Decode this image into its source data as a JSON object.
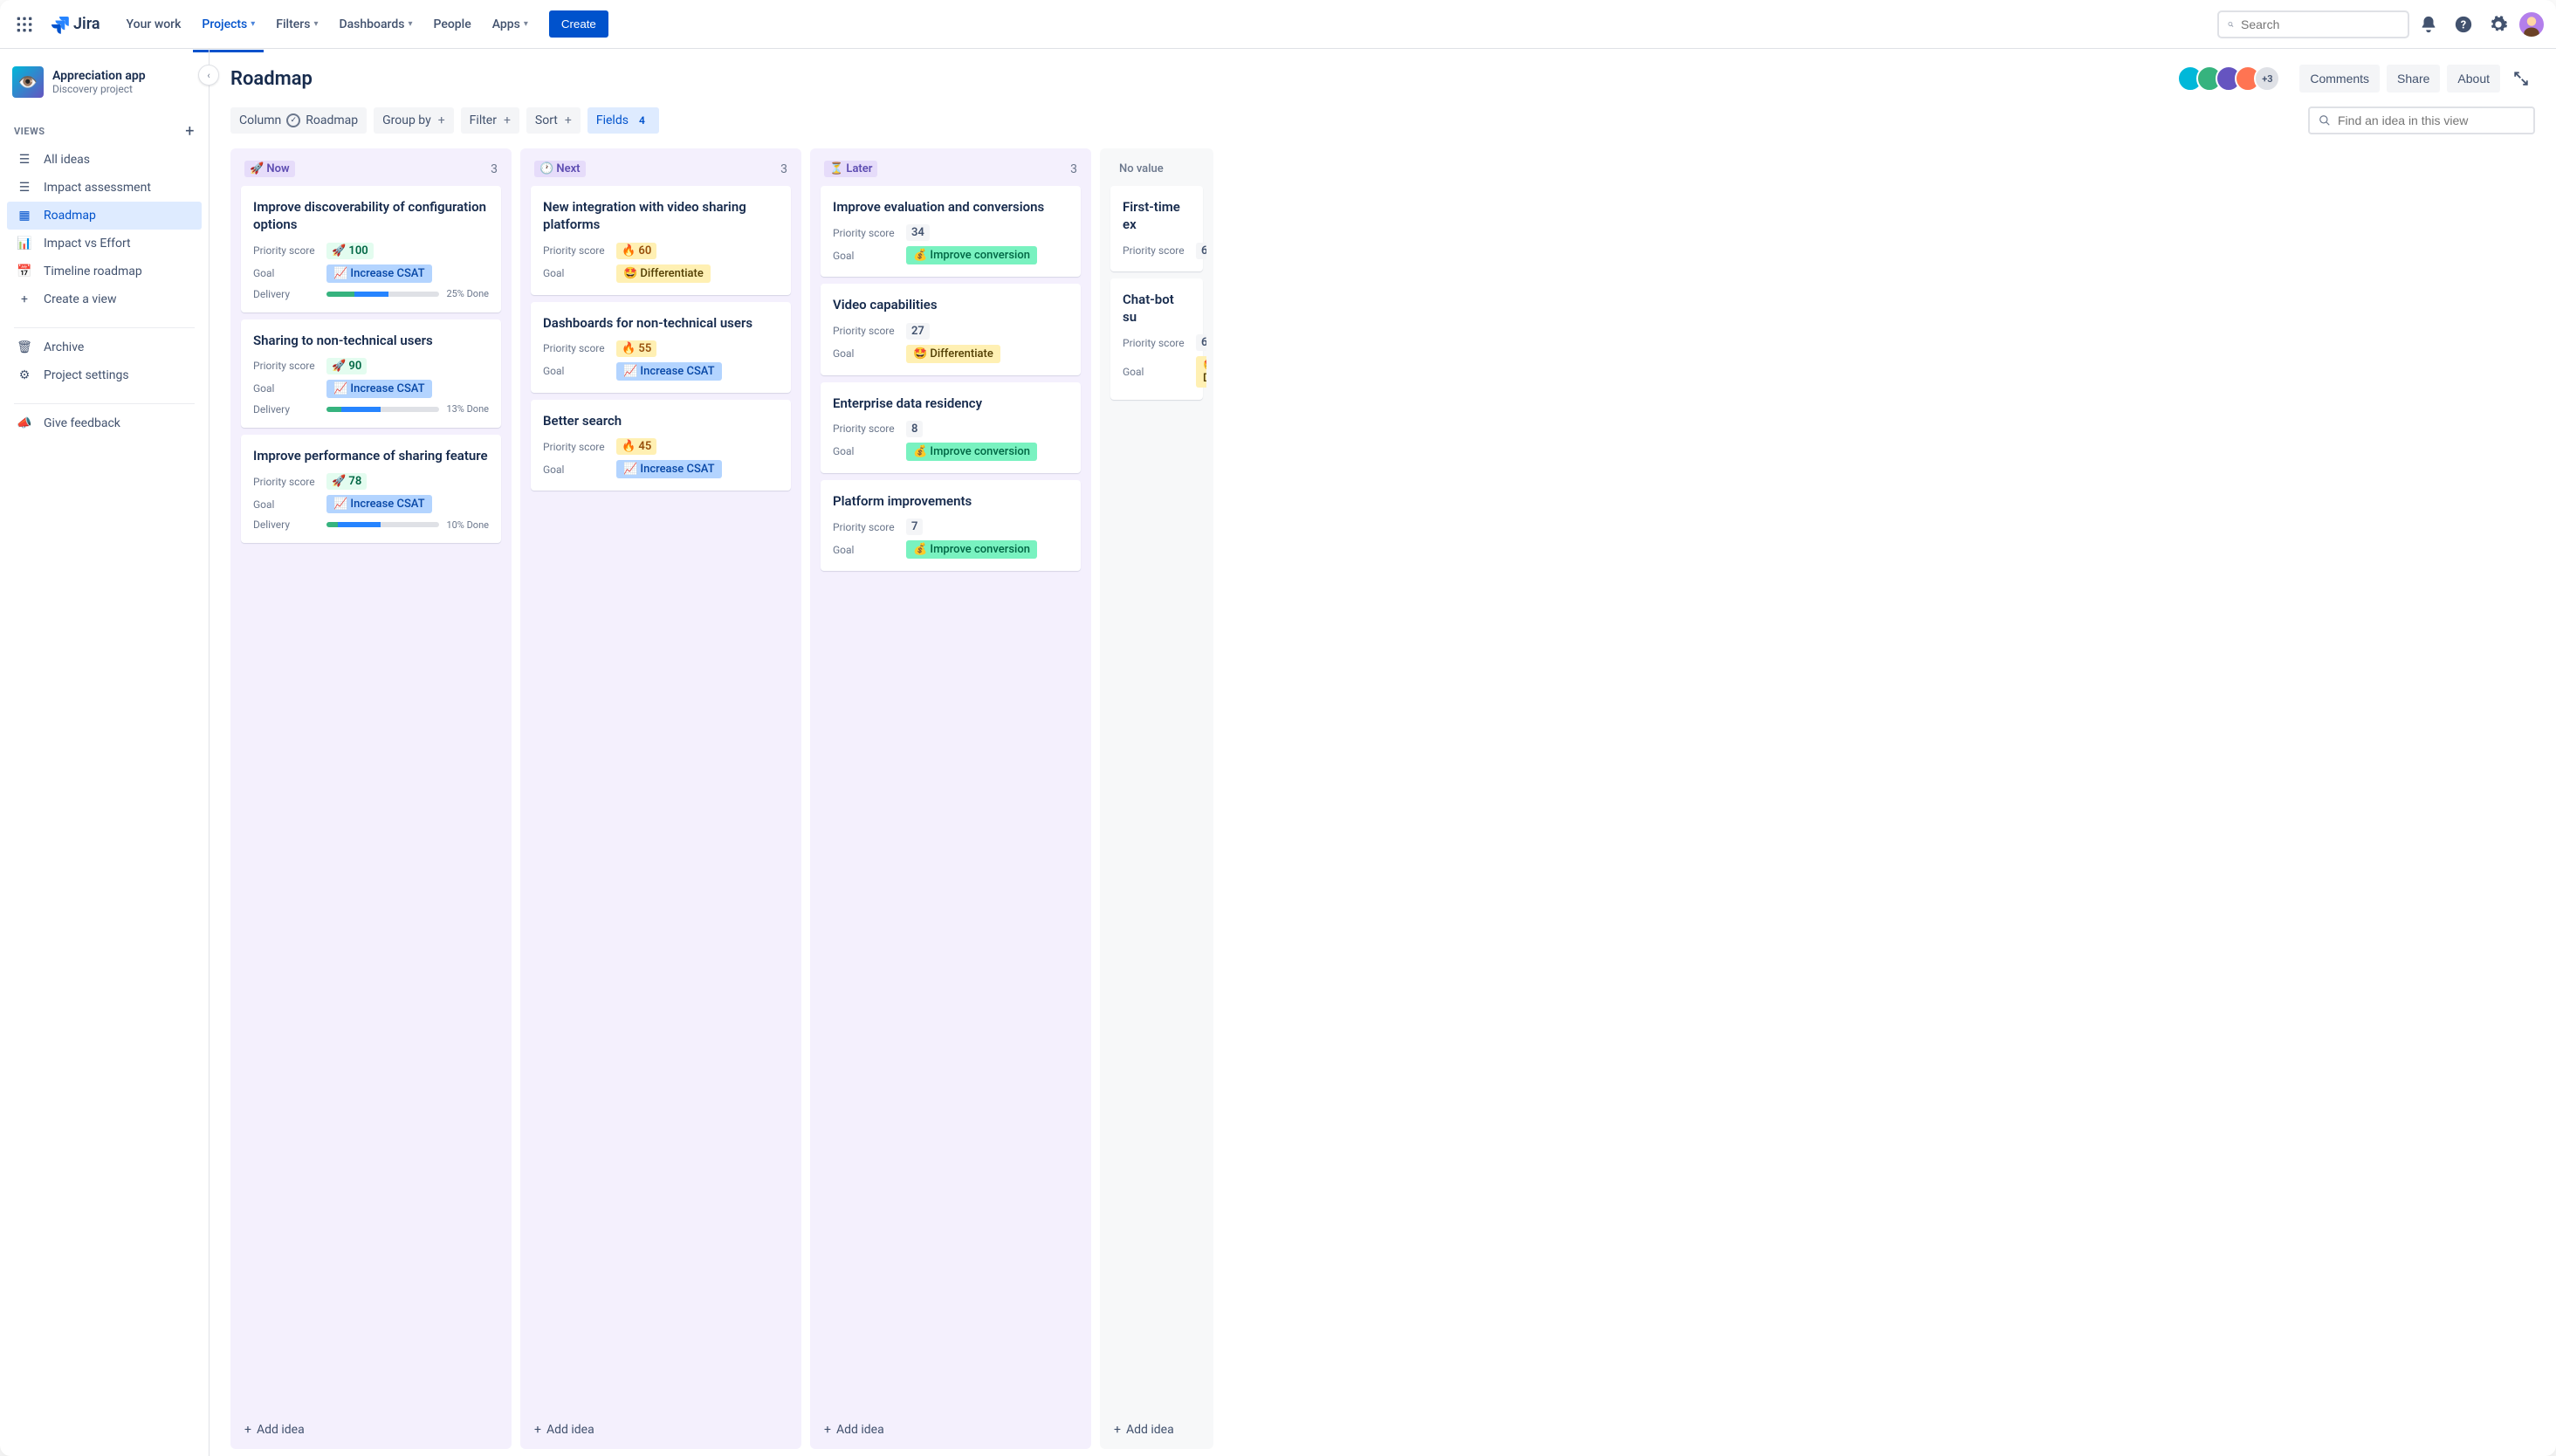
{
  "topnav": {
    "product": "Jira",
    "items": [
      "Your work",
      "Projects",
      "Filters",
      "Dashboards",
      "People",
      "Apps"
    ],
    "items_with_chevron": [
      false,
      true,
      true,
      true,
      false,
      true
    ],
    "active_index": 1,
    "create": "Create",
    "search_placeholder": "Search"
  },
  "sidebar": {
    "project_name": "Appreciation app",
    "project_type": "Discovery project",
    "views_label": "VIEWS",
    "views": [
      {
        "label": "All ideas",
        "icon": "list"
      },
      {
        "label": "Impact assessment",
        "icon": "list"
      },
      {
        "label": "Roadmap",
        "icon": "board",
        "selected": true
      },
      {
        "label": "Impact vs Effort",
        "icon": "chart"
      },
      {
        "label": "Timeline roadmap",
        "icon": "timeline"
      },
      {
        "label": "Create a view",
        "icon": "plus"
      }
    ],
    "archive": "Archive",
    "settings": "Project settings",
    "feedback": "Give feedback"
  },
  "header": {
    "title": "Roadmap",
    "avatar_extra": "+3",
    "comments": "Comments",
    "share": "Share",
    "about": "About"
  },
  "toolbar": {
    "column_label": "Column",
    "column_value": "Roadmap",
    "group_by": "Group by",
    "filter": "Filter",
    "sort": "Sort",
    "fields": "Fields",
    "fields_count": "4",
    "find_placeholder": "Find an idea in this view"
  },
  "field_labels": {
    "priority": "Priority score",
    "goal": "Goal",
    "delivery": "Delivery"
  },
  "goals": {
    "csat": "Increase CSAT",
    "diff": "Differentiate",
    "conv": "Improve conversion"
  },
  "add_idea": "Add idea",
  "columns": [
    {
      "emoji": "🚀",
      "label": "Now",
      "count": "3",
      "cards": [
        {
          "title": "Improve discoverability of configuration options",
          "score_emoji": "🚀",
          "score": "100",
          "score_style": "green",
          "goal": "csat",
          "delivery_done": 25,
          "delivery_progress": 30,
          "delivery_label": "25% Done"
        },
        {
          "title": "Sharing to non-technical users",
          "score_emoji": "🚀",
          "score": "90",
          "score_style": "green",
          "goal": "csat",
          "delivery_done": 13,
          "delivery_progress": 35,
          "delivery_label": "13% Done"
        },
        {
          "title": "Improve performance of sharing feature",
          "score_emoji": "🚀",
          "score": "78",
          "score_style": "green",
          "goal": "csat",
          "delivery_done": 10,
          "delivery_progress": 38,
          "delivery_label": "10% Done"
        }
      ]
    },
    {
      "emoji": "🕐",
      "label": "Next",
      "count": "3",
      "cards": [
        {
          "title": "New integration with video sharing platforms",
          "score_emoji": "🔥",
          "score": "60",
          "score_style": "fire",
          "goal": "diff"
        },
        {
          "title": "Dashboards for non-technical users",
          "score_emoji": "🔥",
          "score": "55",
          "score_style": "fire",
          "goal": "csat"
        },
        {
          "title": "Better search",
          "score_emoji": "🔥",
          "score": "45",
          "score_style": "fire",
          "goal": "csat"
        }
      ]
    },
    {
      "emoji": "⏳",
      "label": "Later",
      "count": "3",
      "cards": [
        {
          "title": "Improve evaluation and conversions",
          "score": "34",
          "score_style": "gray",
          "goal": "conv"
        },
        {
          "title": "Video capabilities",
          "score": "27",
          "score_style": "gray",
          "goal": "diff"
        },
        {
          "title": "Enterprise data residency",
          "score": "8",
          "score_style": "gray",
          "goal": "conv"
        },
        {
          "title": "Platform improvements",
          "score": "7",
          "score_style": "gray",
          "goal": "conv"
        }
      ]
    },
    {
      "label": "No value",
      "plain": true,
      "cards": [
        {
          "title": "First-time ex",
          "score": "6",
          "score_style": "gray"
        },
        {
          "title": "Chat-bot su",
          "score": "6",
          "score_style": "gray",
          "goal": "diff"
        }
      ]
    }
  ]
}
